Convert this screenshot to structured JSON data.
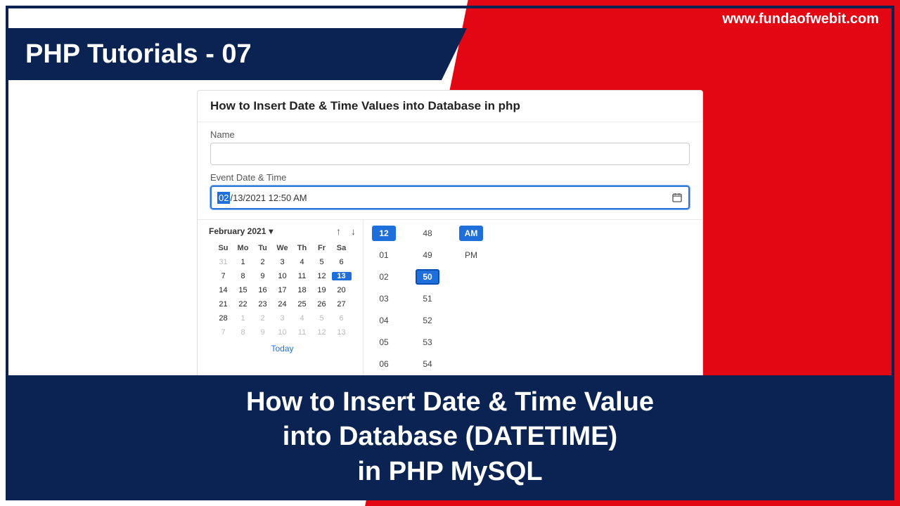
{
  "site_url": "www.fundaofwebit.com",
  "title": "PHP Tutorials - 07",
  "card": {
    "header": "How to Insert Date & Time Values into Database in php",
    "name_label": "Name",
    "name_value": "",
    "dt_label": "Event Date & Time",
    "dt_value": {
      "mm_sel": "02",
      "rest": "/13/2021 12:50 AM"
    }
  },
  "calendar": {
    "month": "February 2021",
    "dow": [
      "Su",
      "Mo",
      "Tu",
      "We",
      "Th",
      "Fr",
      "Sa"
    ],
    "weeks": [
      [
        {
          "d": "31",
          "dim": true
        },
        {
          "d": "1"
        },
        {
          "d": "2"
        },
        {
          "d": "3"
        },
        {
          "d": "4"
        },
        {
          "d": "5"
        },
        {
          "d": "6"
        }
      ],
      [
        {
          "d": "7"
        },
        {
          "d": "8"
        },
        {
          "d": "9"
        },
        {
          "d": "10"
        },
        {
          "d": "11"
        },
        {
          "d": "12"
        },
        {
          "d": "13",
          "sel": true
        }
      ],
      [
        {
          "d": "14"
        },
        {
          "d": "15"
        },
        {
          "d": "16"
        },
        {
          "d": "17"
        },
        {
          "d": "18"
        },
        {
          "d": "19"
        },
        {
          "d": "20"
        }
      ],
      [
        {
          "d": "21"
        },
        {
          "d": "22"
        },
        {
          "d": "23"
        },
        {
          "d": "24"
        },
        {
          "d": "25"
        },
        {
          "d": "26"
        },
        {
          "d": "27"
        }
      ],
      [
        {
          "d": "28"
        },
        {
          "d": "1",
          "dim": true
        },
        {
          "d": "2",
          "dim": true
        },
        {
          "d": "3",
          "dim": true
        },
        {
          "d": "4",
          "dim": true
        },
        {
          "d": "5",
          "dim": true
        },
        {
          "d": "6",
          "dim": true
        }
      ],
      [
        {
          "d": "7",
          "dim": true
        },
        {
          "d": "8",
          "dim": true
        },
        {
          "d": "9",
          "dim": true
        },
        {
          "d": "10",
          "dim": true
        },
        {
          "d": "11",
          "dim": true
        },
        {
          "d": "12",
          "dim": true
        },
        {
          "d": "13",
          "dim": true
        }
      ]
    ],
    "today": "Today"
  },
  "time": {
    "hours": [
      {
        "v": "12",
        "sel": true
      },
      {
        "v": "01"
      },
      {
        "v": "02"
      },
      {
        "v": "03"
      },
      {
        "v": "04"
      },
      {
        "v": "05"
      },
      {
        "v": "06"
      }
    ],
    "mins": [
      {
        "v": "48"
      },
      {
        "v": "49"
      },
      {
        "v": "50",
        "sel": true,
        "box": true
      },
      {
        "v": "51"
      },
      {
        "v": "52"
      },
      {
        "v": "53"
      },
      {
        "v": "54"
      }
    ],
    "ampm": [
      {
        "v": "AM",
        "sel": true
      },
      {
        "v": "PM"
      }
    ]
  },
  "footer": {
    "l1": "How to Insert Date & Time Value",
    "l2": "into Database (DATETIME)",
    "l3": "in PHP MySQL"
  }
}
